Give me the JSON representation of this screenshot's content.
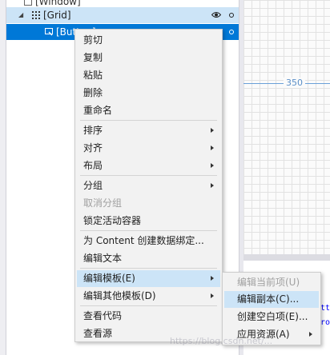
{
  "tree": {
    "window_label": "[Window]",
    "grid_label": "[Grid]",
    "button_label": "[Button]"
  },
  "designer": {
    "dimension_label": "350",
    "code_lines": [
      "tt",
      "ro"
    ]
  },
  "context_menu": {
    "items": [
      {
        "label": "剪切",
        "enabled": true,
        "submenu": false
      },
      {
        "label": "复制",
        "enabled": true,
        "submenu": false
      },
      {
        "label": "粘贴",
        "enabled": true,
        "submenu": false
      },
      {
        "label": "删除",
        "enabled": true,
        "submenu": false
      },
      {
        "label": "重命名",
        "enabled": true,
        "submenu": false
      },
      {
        "label": "排序",
        "enabled": true,
        "submenu": true
      },
      {
        "label": "对齐",
        "enabled": true,
        "submenu": true
      },
      {
        "label": "布局",
        "enabled": true,
        "submenu": true
      },
      {
        "label": "分组",
        "enabled": true,
        "submenu": true
      },
      {
        "label": "取消分组",
        "enabled": false,
        "submenu": false
      },
      {
        "label": "锁定活动容器",
        "enabled": true,
        "submenu": false
      },
      {
        "label": "为 Content 创建数据绑定...",
        "enabled": true,
        "submenu": false
      },
      {
        "label": "编辑文本",
        "enabled": true,
        "submenu": false
      },
      {
        "label": "编辑模板(E)",
        "enabled": true,
        "submenu": true,
        "highlighted": true
      },
      {
        "label": "编辑其他模板(D)",
        "enabled": true,
        "submenu": true
      },
      {
        "label": "查看代码",
        "enabled": true,
        "submenu": false
      },
      {
        "label": "查看源",
        "enabled": true,
        "submenu": false
      }
    ]
  },
  "template_submenu": {
    "items": [
      {
        "label": "编辑当前项(U)",
        "enabled": false,
        "submenu": false
      },
      {
        "label": "编辑副本(C)...",
        "enabled": true,
        "submenu": false,
        "highlighted": true
      },
      {
        "label": "创建空白项(E)...",
        "enabled": true,
        "submenu": false
      },
      {
        "label": "应用资源(A)",
        "enabled": true,
        "submenu": true
      }
    ]
  },
  "watermark": "https://blog.csdn.net/...",
  "colors": {
    "selection": "#0078d7",
    "hover": "#cce4f7",
    "dimension": "#5b8fc8"
  }
}
